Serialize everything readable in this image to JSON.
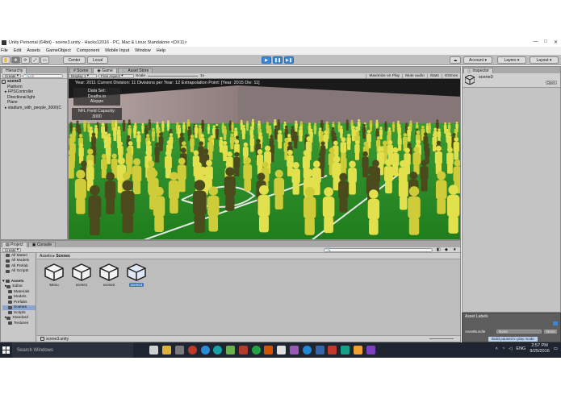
{
  "window": {
    "title": "Unity Personal (64bit) - scene3.unity - Hacks12016 - PC, Mac & Linux Standalone <DX11>",
    "buttons": [
      "—",
      "□",
      "✕"
    ]
  },
  "menu": [
    "File",
    "Edit",
    "Assets",
    "GameObject",
    "Component",
    "Mobile Input",
    "Window",
    "Help"
  ],
  "toolbar": {
    "center_label": "Center",
    "local_label": "Local",
    "account_label": "Account",
    "layers_label": "Layers",
    "layout_label": "Layout"
  },
  "hierarchy": {
    "tab": "Hierarchy",
    "create_label": "Create",
    "search_placeholder": "All",
    "scene": "scene3",
    "items": [
      "Platform",
      "FPSController",
      "Directional light",
      "Plane",
      "stadium_with_people_3000(C"
    ]
  },
  "scene_tabs": [
    "Scene",
    "Game",
    "Asset Store"
  ],
  "game_bar": {
    "display": "Display 1",
    "aspect": "Free Aspect",
    "scale_label": "Scale",
    "scale_value": "1x",
    "options": [
      "Maximize on Play",
      "Mute audio",
      "Stats",
      "Gizmos"
    ]
  },
  "overlay": {
    "info": "Year: 2011   Current Division: 11   Divisions per Year: 12 Extrapolation Point: [Year: 2015  Div: 11]",
    "box1": [
      "Data Set:",
      "Deaths in",
      "Aleppo"
    ],
    "box2": [
      "NFL Field Capacity:",
      "3000"
    ]
  },
  "project": {
    "tabs": [
      "Project",
      "Console"
    ],
    "create_label": "Create",
    "search_placeholder": "",
    "favorites": [
      "All Materi",
      "All Models",
      "All Prefab",
      "All Scripts"
    ],
    "assets_root": "Assets",
    "folders": [
      "Editor",
      "Materials",
      "Models",
      "Prefabs",
      "Scenes",
      "Scripts",
      "Standard",
      "Textures"
    ],
    "breadcrumb": [
      "Assets",
      "Scenes"
    ],
    "files": [
      "Menu",
      "scene1",
      "scene2",
      "scene3"
    ],
    "selected_file": "scene3",
    "status": "scene3.unity"
  },
  "inspector": {
    "tab": "Inspector",
    "object": "scene3",
    "open_label": "Open",
    "asset_labels": "Asset Labels",
    "asset_bundle_label": "AssetBundle",
    "asset_bundle_value": "None",
    "notice": "Build paused in play mode"
  },
  "taskbar": {
    "search_placeholder": "Search Windows",
    "language": "ENG",
    "time": "2:57 PM",
    "date": "9/25/2016",
    "app_colors": [
      "#d0d0d0",
      "#e0b03a",
      "#7a7a7a",
      "#c0392b",
      "#2c8cd8",
      "#18a1a8",
      "#6ab04c",
      "#b23b2b",
      "#25a244",
      "#d35400",
      "#2980b9",
      "#e0e0e0",
      "#9b59b6",
      "#1e8ad6",
      "#3366aa",
      "#8e44ad",
      "#c0392b",
      "#16a085",
      "#f0a030",
      "#7b3fbf"
    ]
  },
  "colors": {
    "unity_gray": "#c2c2c2",
    "play_blue": "#3b86d6",
    "selection_blue": "#3a72c4",
    "field_green": "#1f7d1c",
    "crowd_yellow": "#e3e04e",
    "taskbar": "#1f2530"
  }
}
